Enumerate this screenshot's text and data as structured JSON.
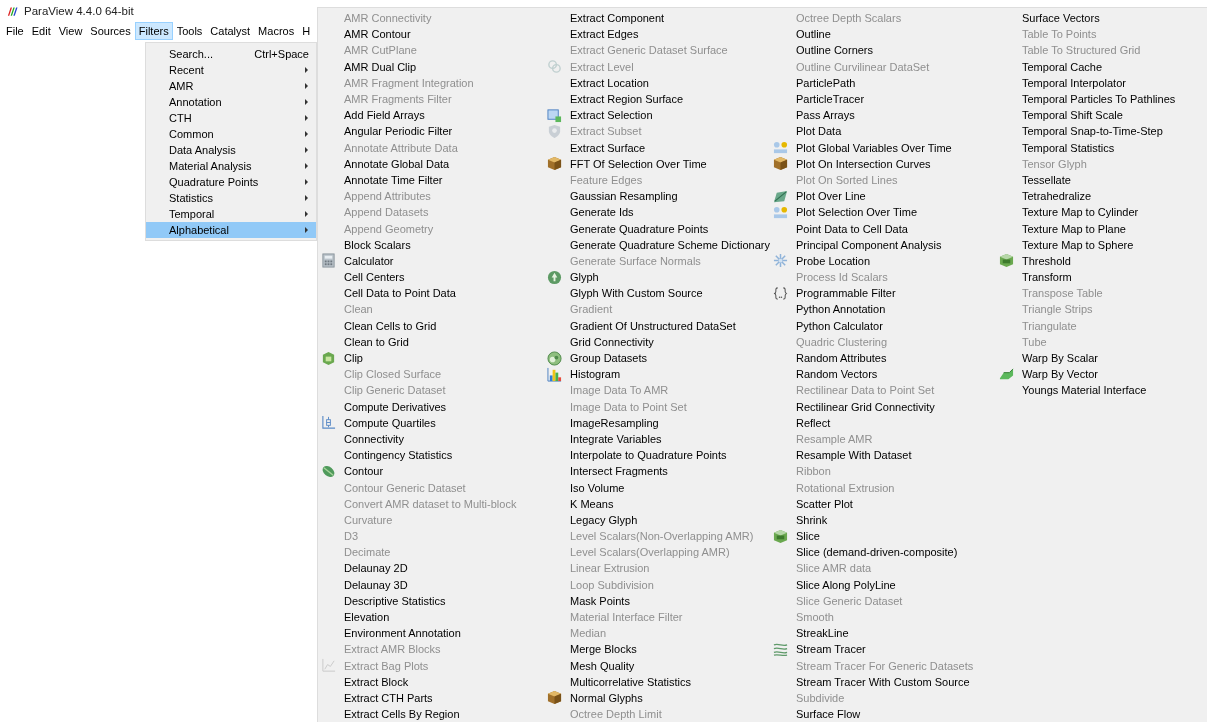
{
  "window": {
    "title": "ParaView 4.4.0 64-bit"
  },
  "menu_bar": {
    "items": [
      {
        "label": "File",
        "selected": false
      },
      {
        "label": "Edit",
        "selected": false
      },
      {
        "label": "View",
        "selected": false
      },
      {
        "label": "Sources",
        "selected": false
      },
      {
        "label": "Filters",
        "selected": true
      },
      {
        "label": "Tools",
        "selected": false
      },
      {
        "label": "Catalyst",
        "selected": false
      },
      {
        "label": "Macros",
        "selected": false
      },
      {
        "label": "H",
        "selected": false
      }
    ]
  },
  "filters_menu": {
    "items": [
      {
        "label": "Search...",
        "shortcut": "Ctrl+Space",
        "submenu": false,
        "selected": false
      },
      {
        "label": "Recent",
        "submenu": true,
        "selected": false
      },
      {
        "label": "AMR",
        "submenu": true,
        "selected": false
      },
      {
        "label": "Annotation",
        "submenu": true,
        "selected": false
      },
      {
        "label": "CTH",
        "submenu": true,
        "selected": false
      },
      {
        "label": "Common",
        "submenu": true,
        "selected": false
      },
      {
        "label": "Data Analysis",
        "submenu": true,
        "selected": false
      },
      {
        "label": "Material Analysis",
        "submenu": true,
        "selected": false
      },
      {
        "label": "Quadrature Points",
        "submenu": true,
        "selected": false
      },
      {
        "label": "Statistics",
        "submenu": true,
        "selected": false
      },
      {
        "label": "Temporal",
        "submenu": true,
        "selected": false
      },
      {
        "label": "Alphabetical",
        "submenu": true,
        "selected": true
      }
    ]
  },
  "alphabetical_menu": {
    "columns": [
      {
        "items": [
          {
            "label": "AMR Connectivity",
            "disabled": true
          },
          {
            "label": "AMR Contour",
            "disabled": false
          },
          {
            "label": "AMR CutPlane",
            "disabled": true
          },
          {
            "label": "AMR Dual Clip",
            "disabled": false
          },
          {
            "label": "AMR Fragment Integration",
            "disabled": true
          },
          {
            "label": "AMR Fragments Filter",
            "disabled": true
          },
          {
            "label": "Add Field Arrays",
            "disabled": false
          },
          {
            "label": "Angular Periodic Filter",
            "disabled": false
          },
          {
            "label": "Annotate Attribute Data",
            "disabled": true
          },
          {
            "label": "Annotate Global Data",
            "disabled": false
          },
          {
            "label": "Annotate Time Filter",
            "disabled": false
          },
          {
            "label": "Append Attributes",
            "disabled": true
          },
          {
            "label": "Append Datasets",
            "disabled": true
          },
          {
            "label": "Append Geometry",
            "disabled": true
          },
          {
            "label": "Block Scalars",
            "disabled": false
          },
          {
            "label": "Calculator",
            "disabled": false,
            "kind": "calculator"
          },
          {
            "label": "Cell Centers",
            "disabled": false
          },
          {
            "label": "Cell Data to Point Data",
            "disabled": false
          },
          {
            "label": "Clean",
            "disabled": true
          },
          {
            "label": "Clean Cells to Grid",
            "disabled": false
          },
          {
            "label": "Clean to Grid",
            "disabled": false
          },
          {
            "label": "Clip",
            "disabled": false,
            "kind": "clip"
          },
          {
            "label": "Clip Closed Surface",
            "disabled": true
          },
          {
            "label": "Clip Generic Dataset",
            "disabled": true
          },
          {
            "label": "Compute Derivatives",
            "disabled": false
          },
          {
            "label": "Compute Quartiles",
            "disabled": false,
            "kind": "boxplot"
          },
          {
            "label": "Connectivity",
            "disabled": false
          },
          {
            "label": "Contingency Statistics",
            "disabled": false
          },
          {
            "label": "Contour",
            "disabled": false,
            "kind": "contour"
          },
          {
            "label": "Contour Generic Dataset",
            "disabled": true
          },
          {
            "label": "Convert AMR dataset to Multi-block",
            "disabled": true
          },
          {
            "label": "Curvature",
            "disabled": true
          },
          {
            "label": "D3",
            "disabled": true
          },
          {
            "label": "Decimate",
            "disabled": true
          },
          {
            "label": "Delaunay 2D",
            "disabled": false
          },
          {
            "label": "Delaunay 3D",
            "disabled": false
          },
          {
            "label": "Descriptive Statistics",
            "disabled": false
          },
          {
            "label": "Elevation",
            "disabled": false
          },
          {
            "label": "Environment Annotation",
            "disabled": false
          },
          {
            "label": "Extract AMR Blocks",
            "disabled": true
          },
          {
            "label": "Extract Bag Plots",
            "disabled": true,
            "kind": "chart"
          },
          {
            "label": "Extract Block",
            "disabled": false
          },
          {
            "label": "Extract CTH Parts",
            "disabled": false
          },
          {
            "label": "Extract Cells By Region",
            "disabled": false
          }
        ]
      },
      {
        "items": [
          {
            "label": "Extract Component",
            "disabled": false
          },
          {
            "label": "Extract Edges",
            "disabled": false
          },
          {
            "label": "Extract Generic Dataset Surface",
            "disabled": true
          },
          {
            "label": "Extract Level",
            "disabled": true,
            "kind": "rings"
          },
          {
            "label": "Extract Location",
            "disabled": false
          },
          {
            "label": "Extract Region Surface",
            "disabled": false
          },
          {
            "label": "Extract Selection",
            "disabled": false,
            "kind": "selection"
          },
          {
            "label": "Extract Subset",
            "disabled": true,
            "kind": "shield"
          },
          {
            "label": "Extract Surface",
            "disabled": false
          },
          {
            "label": "FFT Of Selection Over Time",
            "disabled": false,
            "kind": "cube"
          },
          {
            "label": "Feature Edges",
            "disabled": true
          },
          {
            "label": "Gaussian Resampling",
            "disabled": false
          },
          {
            "label": "Generate Ids",
            "disabled": false
          },
          {
            "label": "Generate Quadrature Points",
            "disabled": false
          },
          {
            "label": "Generate Quadrature Scheme Dictionary",
            "disabled": false
          },
          {
            "label": "Generate Surface Normals",
            "disabled": true
          },
          {
            "label": "Glyph",
            "disabled": false,
            "kind": "glyph"
          },
          {
            "label": "Glyph With Custom Source",
            "disabled": false
          },
          {
            "label": "Gradient",
            "disabled": true
          },
          {
            "label": "Gradient Of Unstructured DataSet",
            "disabled": false
          },
          {
            "label": "Grid Connectivity",
            "disabled": false
          },
          {
            "label": "Group Datasets",
            "disabled": false,
            "kind": "group"
          },
          {
            "label": "Histogram",
            "disabled": false,
            "kind": "histogram"
          },
          {
            "label": "Image Data To AMR",
            "disabled": true
          },
          {
            "label": "Image Data to Point Set",
            "disabled": true
          },
          {
            "label": "ImageResampling",
            "disabled": false
          },
          {
            "label": "Integrate Variables",
            "disabled": false
          },
          {
            "label": "Interpolate to Quadrature Points",
            "disabled": false
          },
          {
            "label": "Intersect Fragments",
            "disabled": false
          },
          {
            "label": "Iso Volume",
            "disabled": false
          },
          {
            "label": "K Means",
            "disabled": false
          },
          {
            "label": "Legacy Glyph",
            "disabled": false
          },
          {
            "label": "Level Scalars(Non-Overlapping AMR)",
            "disabled": true
          },
          {
            "label": "Level Scalars(Overlapping AMR)",
            "disabled": true
          },
          {
            "label": "Linear Extrusion",
            "disabled": true
          },
          {
            "label": "Loop Subdivision",
            "disabled": true
          },
          {
            "label": "Mask Points",
            "disabled": false
          },
          {
            "label": "Material Interface Filter",
            "disabled": true
          },
          {
            "label": "Median",
            "disabled": true
          },
          {
            "label": "Merge Blocks",
            "disabled": false
          },
          {
            "label": "Mesh Quality",
            "disabled": false
          },
          {
            "label": "Multicorrelative Statistics",
            "disabled": false
          },
          {
            "label": "Normal Glyphs",
            "disabled": false,
            "kind": "cube"
          },
          {
            "label": "Octree Depth Limit",
            "disabled": true
          }
        ]
      },
      {
        "items": [
          {
            "label": "Octree Depth Scalars",
            "disabled": true
          },
          {
            "label": "Outline",
            "disabled": false
          },
          {
            "label": "Outline Corners",
            "disabled": false
          },
          {
            "label": "Outline Curvilinear DataSet",
            "disabled": true
          },
          {
            "label": "ParticlePath",
            "disabled": false
          },
          {
            "label": "ParticleTracer",
            "disabled": false
          },
          {
            "label": "Pass Arrays",
            "disabled": false
          },
          {
            "label": "Plot Data",
            "disabled": false
          },
          {
            "label": "Plot Global Variables Over Time",
            "disabled": false,
            "kind": "dots"
          },
          {
            "label": "Plot On Intersection Curves",
            "disabled": false,
            "kind": "cube"
          },
          {
            "label": "Plot On Sorted Lines",
            "disabled": true
          },
          {
            "label": "Plot Over Line",
            "disabled": false,
            "kind": "line"
          },
          {
            "label": "Plot Selection Over Time",
            "disabled": false,
            "kind": "dots"
          },
          {
            "label": "Point Data to Cell Data",
            "disabled": false
          },
          {
            "label": "Principal Component Analysis",
            "disabled": false
          },
          {
            "label": "Probe Location",
            "disabled": false,
            "kind": "probe"
          },
          {
            "label": "Process Id Scalars",
            "disabled": true
          },
          {
            "label": "Programmable Filter",
            "disabled": false,
            "kind": "braces"
          },
          {
            "label": "Python Annotation",
            "disabled": false
          },
          {
            "label": "Python Calculator",
            "disabled": false
          },
          {
            "label": "Quadric Clustering",
            "disabled": true
          },
          {
            "label": "Random Attributes",
            "disabled": false
          },
          {
            "label": "Random Vectors",
            "disabled": false
          },
          {
            "label": "Rectilinear Data to Point Set",
            "disabled": true
          },
          {
            "label": "Rectilinear Grid Connectivity",
            "disabled": false
          },
          {
            "label": "Reflect",
            "disabled": false
          },
          {
            "label": "Resample AMR",
            "disabled": true
          },
          {
            "label": "Resample With Dataset",
            "disabled": false
          },
          {
            "label": "Ribbon",
            "disabled": true
          },
          {
            "label": "Rotational Extrusion",
            "disabled": true
          },
          {
            "label": "Scatter Plot",
            "disabled": false
          },
          {
            "label": "Shrink",
            "disabled": false
          },
          {
            "label": "Slice",
            "disabled": false,
            "kind": "greencube"
          },
          {
            "label": "Slice (demand-driven-composite)",
            "disabled": false
          },
          {
            "label": "Slice AMR data",
            "disabled": true
          },
          {
            "label": "Slice Along PolyLine",
            "disabled": false
          },
          {
            "label": "Slice Generic Dataset",
            "disabled": true
          },
          {
            "label": "Smooth",
            "disabled": true
          },
          {
            "label": "StreakLine",
            "disabled": false
          },
          {
            "label": "Stream Tracer",
            "disabled": false,
            "kind": "streamlines"
          },
          {
            "label": "Stream Tracer For Generic Datasets",
            "disabled": true
          },
          {
            "label": "Stream Tracer With Custom Source",
            "disabled": false
          },
          {
            "label": "Subdivide",
            "disabled": true
          },
          {
            "label": "Surface Flow",
            "disabled": false
          }
        ]
      },
      {
        "items": [
          {
            "label": "Surface Vectors",
            "disabled": false
          },
          {
            "label": "Table To Points",
            "disabled": true
          },
          {
            "label": "Table To Structured Grid",
            "disabled": true
          },
          {
            "label": "Temporal Cache",
            "disabled": false
          },
          {
            "label": "Temporal Interpolator",
            "disabled": false
          },
          {
            "label": "Temporal Particles To Pathlines",
            "disabled": false
          },
          {
            "label": "Temporal Shift Scale",
            "disabled": false
          },
          {
            "label": "Temporal Snap-to-Time-Step",
            "disabled": false
          },
          {
            "label": "Temporal Statistics",
            "disabled": false
          },
          {
            "label": "Tensor Glyph",
            "disabled": true
          },
          {
            "label": "Tessellate",
            "disabled": false
          },
          {
            "label": "Tetrahedralize",
            "disabled": false
          },
          {
            "label": "Texture Map to Cylinder",
            "disabled": false
          },
          {
            "label": "Texture Map to Plane",
            "disabled": false
          },
          {
            "label": "Texture Map to Sphere",
            "disabled": false
          },
          {
            "label": "Threshold",
            "disabled": false,
            "kind": "greencube"
          },
          {
            "label": "Transform",
            "disabled": false
          },
          {
            "label": "Transpose Table",
            "disabled": true
          },
          {
            "label": "Triangle Strips",
            "disabled": true
          },
          {
            "label": "Triangulate",
            "disabled": true
          },
          {
            "label": "Tube",
            "disabled": true
          },
          {
            "label": "Warp By Scalar",
            "disabled": false
          },
          {
            "label": "Warp By Vector",
            "disabled": false,
            "kind": "warp"
          },
          {
            "label": "Youngs Material Interface",
            "disabled": false
          }
        ]
      }
    ]
  }
}
